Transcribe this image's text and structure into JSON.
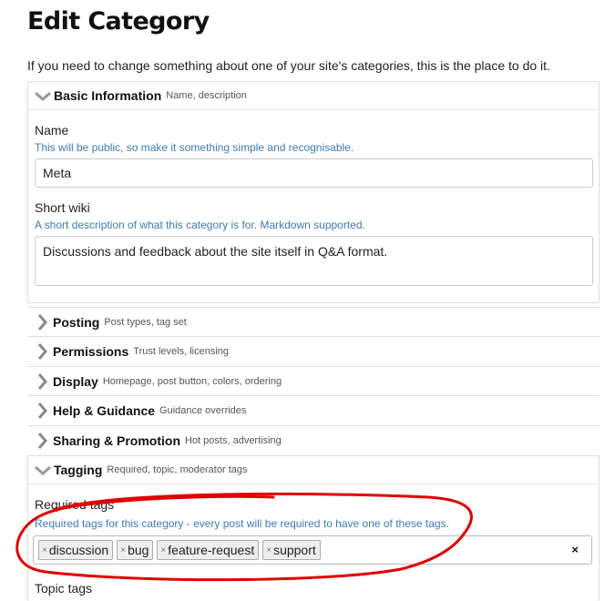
{
  "page": {
    "title": "Edit Category",
    "intro": "If you need to change something about one of your site's categories, this is the place to do it."
  },
  "sections": {
    "basic": {
      "title": "Basic Information",
      "subtitle": "Name, description",
      "name_label": "Name",
      "name_help": "This will be public, so make it something simple and recognisable.",
      "name_value": "Meta",
      "wiki_label": "Short wiki",
      "wiki_help": "A short description of what this category is for. Markdown supported.",
      "wiki_value": "Discussions and feedback about the site itself in Q&A format."
    },
    "posting": {
      "title": "Posting",
      "subtitle": "Post types, tag set"
    },
    "permissions": {
      "title": "Permissions",
      "subtitle": "Trust levels, licensing"
    },
    "display": {
      "title": "Display",
      "subtitle": "Homepage, post button, colors, ordering"
    },
    "help": {
      "title": "Help & Guidance",
      "subtitle": "Guidance overrides"
    },
    "sharing": {
      "title": "Sharing & Promotion",
      "subtitle": "Hot posts, advertising"
    },
    "tagging": {
      "title": "Tagging",
      "subtitle": "Required, topic, moderator tags",
      "required_label": "Required tags",
      "required_help": "Required tags for this category - every post will be required to have one of these tags.",
      "required_tags": [
        "discussion",
        "bug",
        "feature-request",
        "support"
      ],
      "tag_remove_glyph": "×",
      "clear_glyph": "×",
      "topic_label": "Topic tags"
    }
  },
  "annotation": {
    "color": "#e00000"
  }
}
